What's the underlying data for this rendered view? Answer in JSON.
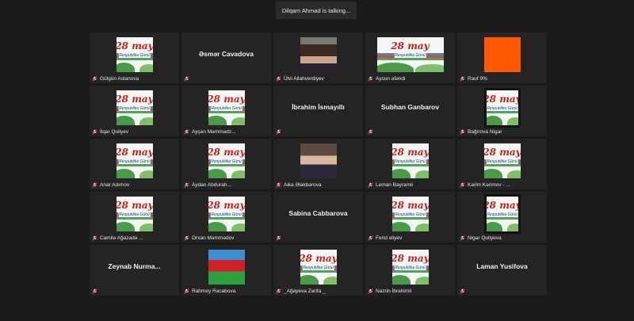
{
  "banner": {
    "speaking": "Dilqam Ahmad is talking..."
  },
  "poster": {
    "num": "28 may",
    "sub": "Respublika Günü"
  },
  "colors": {
    "muted": "#e23b3b",
    "orange": "#ff5a00",
    "tile": "#242424"
  },
  "tiles": [
    {
      "name": "Gülgün Aslanova",
      "kind": "poster"
    },
    {
      "name": "Əsmər Cavadova",
      "kind": "name"
    },
    {
      "name": "Ülvi Allahverdiyev",
      "kind": "face2"
    },
    {
      "name": "Aysun əfəndi",
      "kind": "poster-wide"
    },
    {
      "name": "Rauf 9%",
      "kind": "orange"
    },
    {
      "name": "İlqar Quliyev",
      "kind": "poster"
    },
    {
      "name": "Ayşən Məmmədz...",
      "kind": "poster"
    },
    {
      "name": "İbrahim İsmayıllı",
      "kind": "name"
    },
    {
      "name": "Subhan Ganbarov",
      "kind": "name"
    },
    {
      "name": "Bağırova Nigar",
      "kind": "poster-dark"
    },
    {
      "name": "Anar Adımov",
      "kind": "poster"
    },
    {
      "name": "Aydan Abdurah...",
      "kind": "poster"
    },
    {
      "name": "Aika Ələkbərova",
      "kind": "face"
    },
    {
      "name": "Leman Bayramli",
      "kind": "poster"
    },
    {
      "name": "Karim Kərimov - ...",
      "kind": "poster"
    },
    {
      "name": "Camilə Ağazadə ...",
      "kind": "poster"
    },
    {
      "name": "Orxan Məmmədov",
      "kind": "poster"
    },
    {
      "name": "Sabina Cabbarova",
      "kind": "name"
    },
    {
      "name": "Ferid əliyev",
      "kind": "poster"
    },
    {
      "name": "Nigar Quliyeva",
      "kind": "poster-dark"
    },
    {
      "name": "Zeynab  Nurma...",
      "kind": "name"
    },
    {
      "name": "Rahmey Racabova",
      "kind": "flag"
    },
    {
      "name": "_Ağayeva Zarifa _",
      "kind": "poster"
    },
    {
      "name": "Nəzrin İbrahimli",
      "kind": "poster"
    },
    {
      "name": "Laman Yusifova",
      "kind": "name"
    }
  ]
}
